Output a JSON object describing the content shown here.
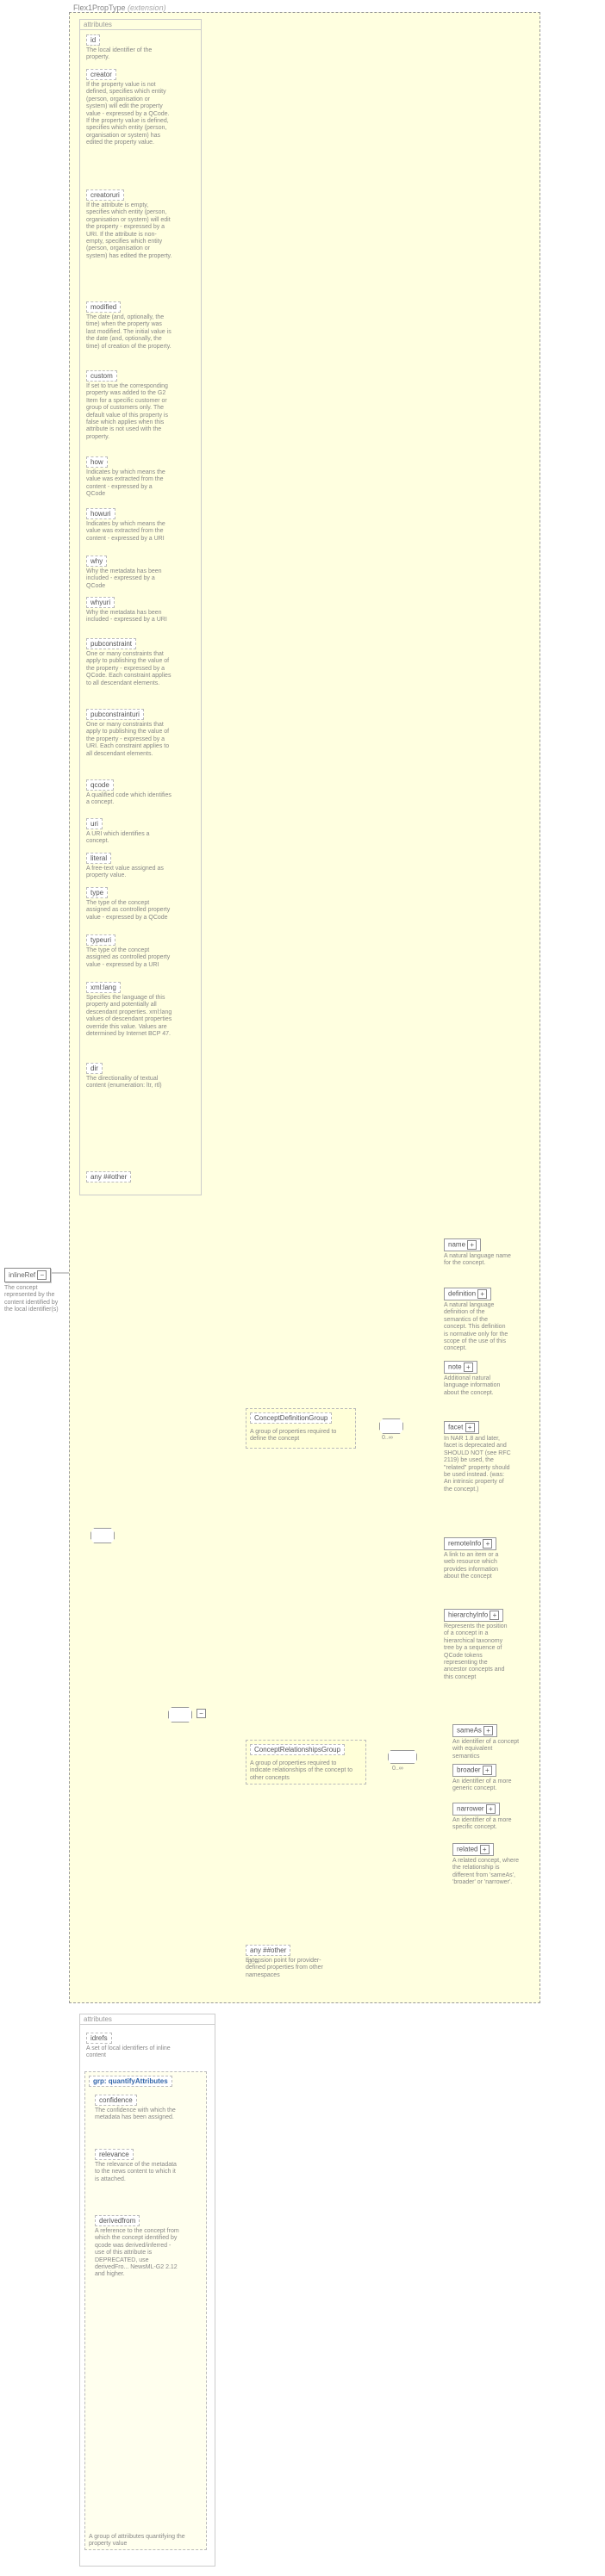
{
  "header": {
    "type_label": "Flex1PropType",
    "extension": "(extension)"
  },
  "root_element": {
    "name": "inlineRef",
    "desc": "The concept represented by the content identified by the local identifier(s)"
  },
  "sections": {
    "attributes": "attributes"
  },
  "attrs1": [
    {
      "name": "id",
      "desc": "The local identifier of the property."
    },
    {
      "name": "creator",
      "desc": "If the property value is not defined, specifies which entity (person, organisation or system) will edit the property value - expressed by a QCode. If the property value is defined, specifies which entity (person, organisation or system) has edited the property value."
    },
    {
      "name": "creatoruri",
      "desc": "If the attribute is empty, specifies which entity (person, organisation or system) will edit the property - expressed by a URI. If the attribute is non-empty, specifies which entity (person, organisation or system) has edited the property."
    },
    {
      "name": "modified",
      "desc": "The date (and, optionally, the time) when the property was last modified. The initial value is the date (and, optionally, the time) of creation of the property."
    },
    {
      "name": "custom",
      "desc": "If set to true the corresponding property was added to the G2 Item for a specific customer or group of customers only. The default value of this property is false which applies when this attribute is not used with the property."
    },
    {
      "name": "how",
      "desc": "Indicates by which means the value was extracted from the content - expressed by a QCode"
    },
    {
      "name": "howuri",
      "desc": "Indicates by which means the value was extracted from the content - expressed by a URI"
    },
    {
      "name": "why",
      "desc": "Why the metadata has been included - expressed by a QCode"
    },
    {
      "name": "whyuri",
      "desc": "Why the metadata has been included - expressed by a URI"
    },
    {
      "name": "pubconstraint",
      "desc": "One or many constraints that apply to publishing the value of the property - expressed by a QCode. Each constraint applies to all descendant elements."
    },
    {
      "name": "pubconstrainturi",
      "desc": "One or many constraints that apply to publishing the value of the property - expressed by a URI. Each constraint applies to all descendant elements."
    },
    {
      "name": "qcode",
      "desc": "A qualified code which identifies a concept."
    },
    {
      "name": "uri",
      "desc": "A URI which identifies a concept."
    },
    {
      "name": "literal",
      "desc": "A free-text value assigned as property value."
    },
    {
      "name": "type",
      "desc": "The type of the concept assigned as controlled property value - expressed by a QCode"
    },
    {
      "name": "typeuri",
      "desc": "The type of the concept assigned as controlled property value - expressed by a URI"
    },
    {
      "name": "xml:lang",
      "desc": "Specifies the language of this property and potentially all descendant properties. xml:lang values of descendant properties override this value. Values are determined by Internet BCP 47."
    },
    {
      "name": "dir",
      "desc": "The directionality of textual content (enumeration: ltr, rtl)"
    }
  ],
  "any_other": "any ##other",
  "concept_def_group": {
    "name": "ConceptDefinitionGroup",
    "desc": "A group of properties required to define the concept"
  },
  "concept_rel_group": {
    "name": "ConceptRelationshipsGroup",
    "desc": "A group of properties required to indicate relationships of the concept to other concepts"
  },
  "def_children": [
    {
      "name": "name",
      "desc": "A natural language name for the concept."
    },
    {
      "name": "definition",
      "desc": "A natural language definition of the semantics of the concept. This definition is normative only for the scope of the use of this concept."
    },
    {
      "name": "note",
      "desc": "Additional natural language information about the concept."
    },
    {
      "name": "facet",
      "desc": "In NAR 1.8 and later, facet is deprecated and SHOULD NOT (see RFC 2119) be used, the \"related\" property should be used instead. (was: An intrinsic property of the concept.)"
    },
    {
      "name": "remoteInfo",
      "desc": "A link to an item or a web resource which provides information about the concept"
    },
    {
      "name": "hierarchyInfo",
      "desc": "Represents the position of a concept in a hierarchical taxonomy tree by a sequence of QCode tokens representing the ancestor concepts and this concept"
    }
  ],
  "rel_children": [
    {
      "name": "sameAs",
      "desc": "An identifier of a concept with equivalent semantics"
    },
    {
      "name": "broader",
      "desc": "An identifier of a more generic concept."
    },
    {
      "name": "narrower",
      "desc": "An identifier of a more specific concept."
    },
    {
      "name": "related",
      "desc": "A related concept, where the relationship is different from 'sameAs', 'broader' or 'narrower'."
    }
  ],
  "any_ext": {
    "name": "any ##other",
    "desc": "Extension point for provider-defined properties from other namespaces"
  },
  "card": {
    "zero_inf": "0..∞"
  },
  "attrs2": {
    "idrefs": {
      "name": "idrefs",
      "desc": "A set of local identifiers of inline content"
    },
    "group": {
      "name": "grp: quantifyAttributes",
      "desc": "A group of attriibutes quantifying the property value"
    },
    "items": [
      {
        "name": "confidence",
        "desc": "The confidence with which the metadata has been assigned."
      },
      {
        "name": "relevance",
        "desc": "The relevance of the metadata to the news content to which it is attached."
      },
      {
        "name": "derivedfrom",
        "desc": "A reference to the concept from which the concept identified by qcode was derived/inferred - use of this attribute is DEPRECATED, use derivedFro... NewsML-G2 2.12 and higher."
      }
    ]
  }
}
